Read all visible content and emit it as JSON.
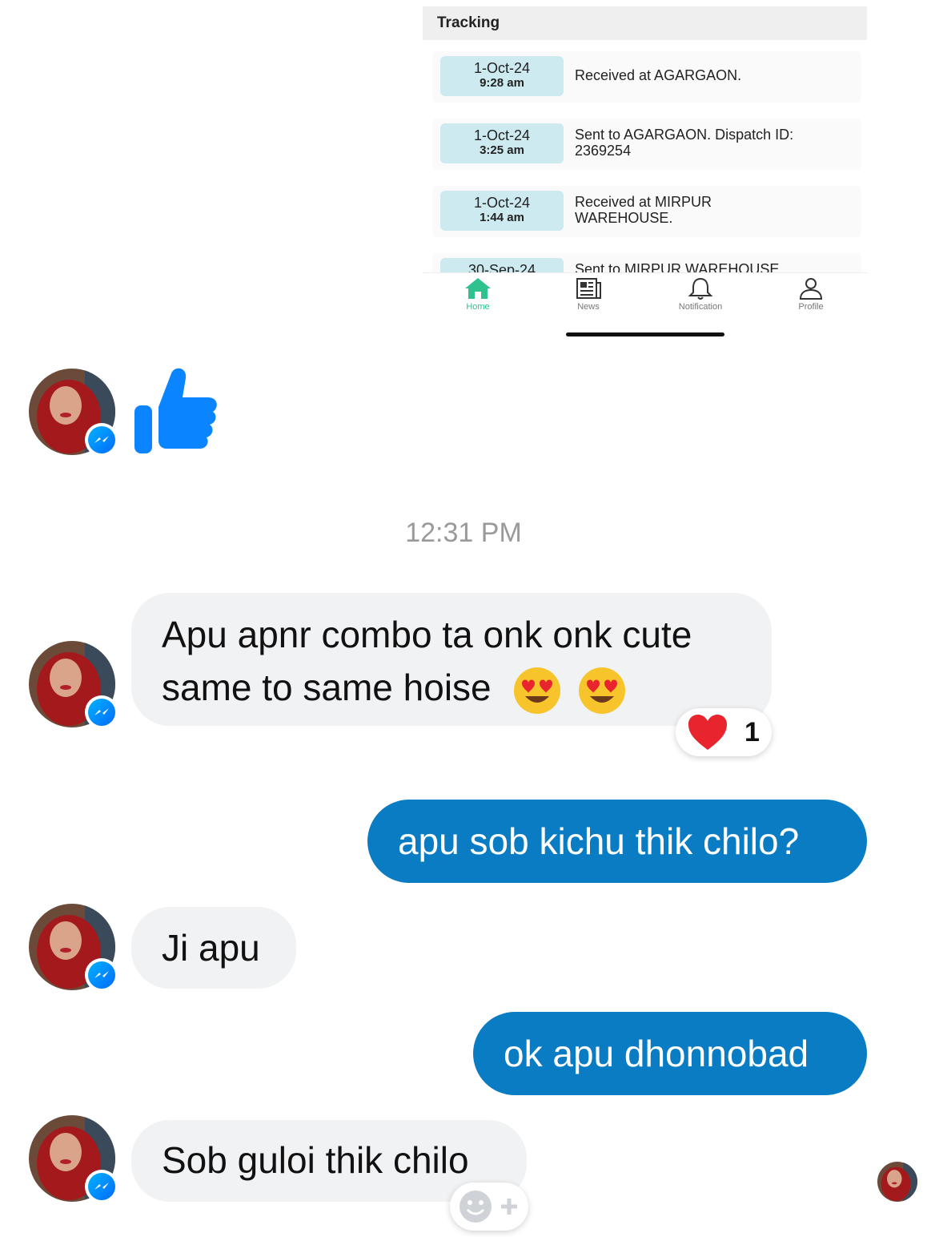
{
  "tracking": {
    "title": "Tracking",
    "rows": [
      {
        "date": "1-Oct-24",
        "time": "9:28 am",
        "text": "Received at AGARGAON."
      },
      {
        "date": "1-Oct-24",
        "time": "3:25 am",
        "text": "Sent to AGARGAON. Dispatch ID: 2369254"
      },
      {
        "date": "1-Oct-24",
        "time": "1:44 am",
        "text": "Received at MIRPUR WAREHOUSE."
      },
      {
        "date": "30-Sep-24",
        "time": "",
        "text": "Sent to MIRPUR WAREHOUSE"
      }
    ],
    "tabs": [
      {
        "label": "Home",
        "icon": "home-icon"
      },
      {
        "label": "News",
        "icon": "newspaper-icon"
      },
      {
        "label": "Notification",
        "icon": "bell-icon"
      },
      {
        "label": "Profile",
        "icon": "person-icon"
      }
    ],
    "active_color": "#2fc28e"
  },
  "chat": {
    "timestamp": "12:31 PM",
    "like_color": "#0a84ff",
    "messages": [
      {
        "from": "them",
        "text_line1": "Apu apnr combo ta onk onk cute",
        "text_line2": "same to same hoise",
        "emojis": [
          "heart-eyes",
          "heart-eyes"
        ],
        "reaction": {
          "emoji": "red-heart",
          "count": "1"
        }
      },
      {
        "from": "me",
        "text": "apu sob kichu thik chilo?"
      },
      {
        "from": "them",
        "text": "Ji apu"
      },
      {
        "from": "me",
        "text": "ok apu dhonnobad"
      },
      {
        "from": "them",
        "text": "Sob guloi thik chilo"
      }
    ],
    "bubble_out_color": "#0a7cc4",
    "bubble_in_color": "#f1f2f4"
  }
}
